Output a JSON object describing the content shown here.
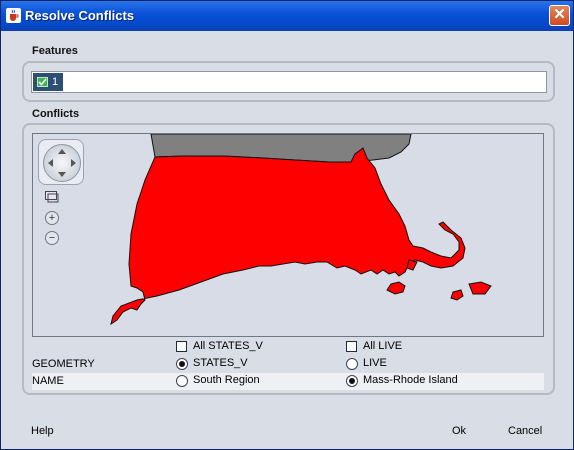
{
  "window": {
    "title": "Resolve Conflicts",
    "close_icon": "close-icon",
    "app_icon": "java-cup-icon",
    "accent": "#0a52d8"
  },
  "features": {
    "label": "Features",
    "items": [
      {
        "checked": true,
        "label": "1"
      }
    ]
  },
  "conflicts": {
    "label": "Conflicts",
    "map": {
      "shape_color": "#ff0000",
      "neighbor_color": "#808080",
      "controls": [
        "pan-control-icon",
        "zoom-box-icon",
        "zoom-in-icon",
        "zoom-out-icon"
      ]
    },
    "all_options": [
      {
        "label": "All STATES_V",
        "checked": false
      },
      {
        "label": "All LIVE",
        "checked": false
      }
    ],
    "rows": [
      {
        "field": "GEOMETRY",
        "left": {
          "label": "STATES_V",
          "selected": true
        },
        "right": {
          "label": "LIVE",
          "selected": false
        }
      },
      {
        "field": "NAME",
        "left": {
          "label": "South Region",
          "selected": false
        },
        "right": {
          "label": "Mass-Rhode Island",
          "selected": true
        }
      }
    ]
  },
  "footer": {
    "help": "Help",
    "ok": "Ok",
    "cancel": "Cancel"
  }
}
